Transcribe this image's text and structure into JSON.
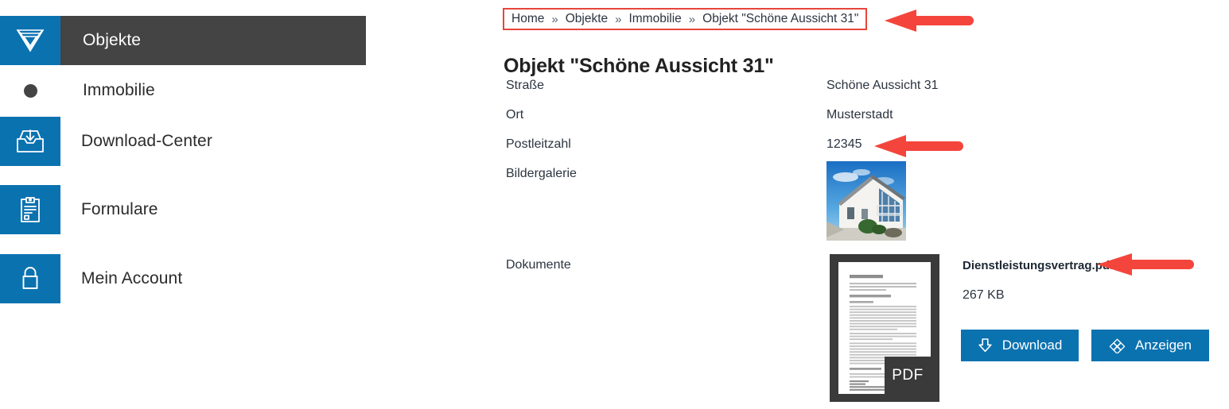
{
  "colors": {
    "accent_blue": "#0b72b0",
    "active_nav_bg": "#444444",
    "annotation_red": "#e8453c",
    "text_dark": "#2b3440"
  },
  "sidebar": {
    "logo_icon": "triangle-logo-icon",
    "items": [
      {
        "label": "Objekte",
        "icon": "triangle-logo-icon",
        "active": true,
        "sub": false
      },
      {
        "label": "Immobilie",
        "icon": "dot-icon",
        "active": false,
        "sub": true
      },
      {
        "label": "Download-Center",
        "icon": "inbox-download-icon",
        "active": false,
        "sub": false
      },
      {
        "label": "Formulare",
        "icon": "clipboard-icon",
        "active": false,
        "sub": false
      },
      {
        "label": "Mein Account",
        "icon": "lock-icon",
        "active": false,
        "sub": false
      }
    ]
  },
  "breadcrumb": {
    "separator": "»",
    "items": [
      "Home",
      "Objekte",
      "Immobilie",
      "Objekt \"Schöne Aussicht 31\""
    ]
  },
  "main": {
    "title": "Objekt \"Schöne Aussicht 31\"",
    "fields": [
      {
        "label": "Straße",
        "value": "Schöne Aussicht 31"
      },
      {
        "label": "Ort",
        "value": "Musterstadt"
      },
      {
        "label": "Postleitzahl",
        "value": "12345"
      },
      {
        "label": "Bildergalerie",
        "value": ""
      },
      {
        "label": "Dokumente",
        "value": ""
      }
    ],
    "gallery": {
      "alt": "house-photo"
    },
    "document": {
      "badge": "PDF",
      "name": "Dienstleistungsvertrag.pdf",
      "size": "267 KB",
      "page_heading": "Vertragsbedingungen",
      "buttons": [
        {
          "label": "Download",
          "icon": "download-arrow-icon"
        },
        {
          "label": "Anzeigen",
          "icon": "diamond-cluster-icon"
        }
      ]
    }
  },
  "annotations": {
    "arrows": [
      {
        "name": "breadcrumb-arrow",
        "points_to": "breadcrumb"
      },
      {
        "name": "postal-code-arrow",
        "points_to": "Postleitzahl value 12345"
      },
      {
        "name": "file-name-arrow",
        "points_to": "Dienstleistungsvertrag.pdf"
      }
    ]
  }
}
